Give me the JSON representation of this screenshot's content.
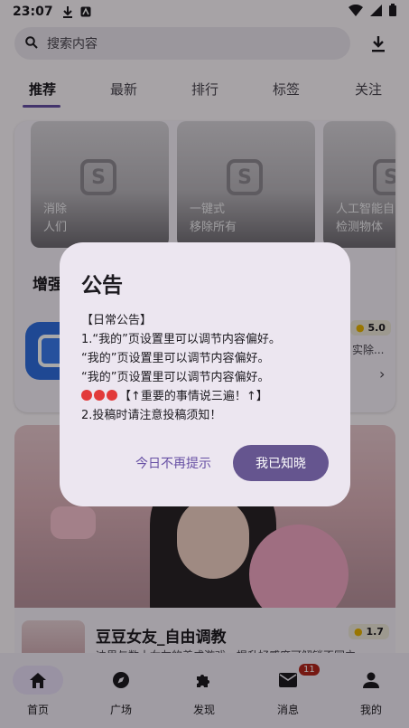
{
  "status_bar": {
    "time": "23:07"
  },
  "search": {
    "placeholder": "搜索内容"
  },
  "tabs": [
    {
      "label": "推荐",
      "active": true
    },
    {
      "label": "最新"
    },
    {
      "label": "排行"
    },
    {
      "label": "标签"
    },
    {
      "label": "关注"
    }
  ],
  "feature_cards": [
    {
      "line1": "消除",
      "line2": "人们"
    },
    {
      "line1": "一键式",
      "line2": "移除所有"
    },
    {
      "line1": "人工智能自",
      "line2": "检测物体"
    }
  ],
  "section": {
    "title": "增强"
  },
  "app1": {
    "rating": "5.0",
    "desc": "实除..."
  },
  "app2": {
    "title": "豆豆女友_自由调教",
    "rating": "1.7",
    "desc": "迪里与数十女友的养成游戏，提升好感度可解锁不同立"
  },
  "bottom_nav": [
    {
      "label": "首页",
      "icon": "home-icon",
      "active": true
    },
    {
      "label": "广场",
      "icon": "compass-icon"
    },
    {
      "label": "发现",
      "icon": "puzzle-icon"
    },
    {
      "label": "消息",
      "icon": "mail-icon",
      "badge": "11"
    },
    {
      "label": "我的",
      "icon": "person-icon"
    }
  ],
  "dialog": {
    "title": "公告",
    "lines": [
      "【日常公告】",
      "1.“我的”页设置里可以调节内容偏好。",
      "“我的”页设置里可以调节内容偏好。",
      "“我的”页设置里可以调节内容偏好。",
      "【↑重要的事情说三遍！↑】",
      "2.投稿时请注意投稿须知！"
    ],
    "dismiss_label": "今日不再提示",
    "confirm_label": "我已知晓"
  },
  "colors": {
    "accent": "#65558f",
    "dialog_bg": "#ece6f0",
    "badge": "#b3261e"
  }
}
